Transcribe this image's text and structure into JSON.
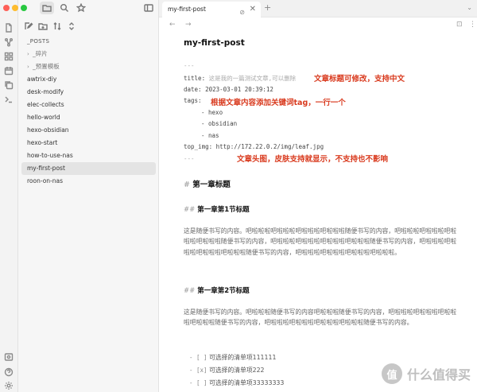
{
  "window": {
    "traffic_colors": [
      "#fe5f57",
      "#febc2e",
      "#28c840"
    ]
  },
  "ribbon": {
    "icons": [
      "files-icon",
      "graph-icon",
      "grid-icon",
      "calendar-icon",
      "copy-icon",
      "terminal-icon",
      "vault-icon",
      "help-icon",
      "settings-icon"
    ]
  },
  "sidebar": {
    "top_icons": [
      "folder-icon",
      "search-icon",
      "star-icon",
      "sidebar-toggle-icon"
    ],
    "action_icons": [
      "new-note-icon",
      "new-folder-icon",
      "sort-icon",
      "collapse-icon"
    ],
    "items": [
      {
        "label": "_POSTS",
        "kind": "root"
      },
      {
        "label": "_碎片",
        "kind": "folder"
      },
      {
        "label": "_预置模板",
        "kind": "folder"
      },
      {
        "label": "awtrix-diy",
        "kind": "file"
      },
      {
        "label": "desk-modify",
        "kind": "file"
      },
      {
        "label": "elec-collects",
        "kind": "file"
      },
      {
        "label": "hello-world",
        "kind": "file"
      },
      {
        "label": "hexo-obsidian",
        "kind": "file"
      },
      {
        "label": "hexo-start",
        "kind": "file"
      },
      {
        "label": "how-to-use-nas",
        "kind": "file"
      },
      {
        "label": "my-first-post",
        "kind": "file",
        "selected": true
      },
      {
        "label": "roon-on-nas",
        "kind": "file"
      }
    ]
  },
  "tabs": {
    "active_label": "my-first-post",
    "close_glyph": "✕",
    "new_glyph": "+",
    "pin_glyph": "⊘",
    "menu_glyph": "⌄"
  },
  "nav": {
    "back": "←",
    "forward": "→",
    "reading_glyph": "⊡",
    "more_glyph": "⋮"
  },
  "doc": {
    "title": "my-first-post",
    "frontmatter": {
      "open": "---",
      "title_key": "title:",
      "title_value": "这是我的一篇测试文章,可以删除",
      "date": "date: 2023-03-01 20:39:12",
      "tags_key": "tags:",
      "tags": [
        "- hexo",
        "- obsidian",
        "- nas"
      ],
      "top_img": "top_img: http://172.22.0.2/img/leaf.jpg",
      "close": "---"
    },
    "annotations": {
      "title": "文章标题可修改，支持中文",
      "tags": "根据文章内容添加关键词tag，一行一个",
      "top_img": "文章头图，皮肤支持就显示，不支持也不影响"
    },
    "h1_hash": "#",
    "h1": "第一章标题",
    "h2_hash": "##",
    "h2a": "第一章第1节标题",
    "para1": "这是随便书写的内容。吧啦啦啦吧啦啦啦吧啦啦啦吧啦啦啦随便书写的内容，吧啦啦啦吧啦啦啦吧啦啦啦吧啦啦啦随便书写的内容，吧啦啦啦吧啦啦啦吧啦啦啦吧啦啦啦随便书写的内容，吧啦啦啦吧啦啦啦吧啦啦啦吧啦啦啦随便书写的内容，吧啦啦啦吧啦啦啦吧啦啦啦吧啦啦啦。",
    "h2b": "第一章第2节标题",
    "para2": "这是随便书写的内容。吧啦啦啦随便书写的内容吧啦啦啦随便书写的内容，吧啦啦啦吧啦啦啦吧啦啦啦吧啦啦啦随便书写的内容，吧啦啦啦吧啦啦啦吧啦啦啦吧啦啦啦随便书写的内容。",
    "todos": [
      {
        "mark": "- [ ]",
        "text": "可选择的清单项111111"
      },
      {
        "mark": "- [x]",
        "text": "可选择的清单项222"
      },
      {
        "mark": "- [ ]",
        "text": "可选择的清单项33333333"
      }
    ]
  },
  "watermark": {
    "logo": "值",
    "text": "什么值得买"
  }
}
